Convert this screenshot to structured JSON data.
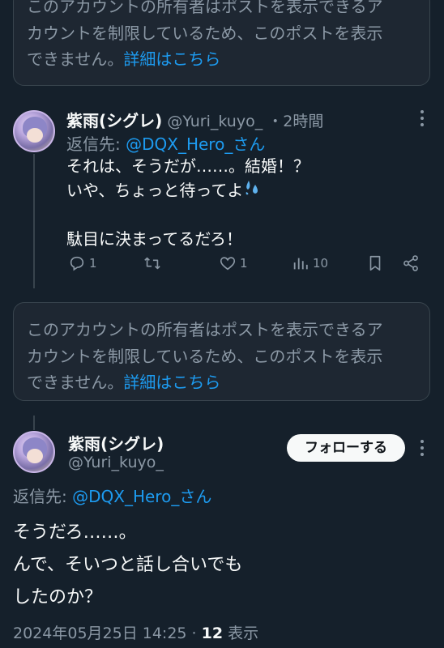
{
  "notice_top": {
    "lines": [
      "このアカウントの所有者はポストを表示できるア",
      "カウントを制限しているため、このポストを表示",
      "できません。"
    ],
    "link": "詳細はこちら"
  },
  "tweet1": {
    "display_name": "紫雨(シグレ)",
    "handle": "@Yuri_kuyo_",
    "time": "・2時間",
    "reply_prefix": "返信先: ",
    "reply_handle": "@DQX_Hero_さん",
    "body_lines": [
      "それは、そうだが……。結婚！？",
      "いや、ちょっと待ってよ",
      "",
      "駄目に決まってるだろ！"
    ],
    "emoji_icon": "sweat-drops-icon",
    "actions": {
      "reply_count": "1",
      "retweet_count": "",
      "like_count": "1",
      "view_count": "10"
    }
  },
  "notice_bottom": {
    "lines": [
      "このアカウントの所有者はポストを表示できるア",
      "カウントを制限しているため、このポストを表示",
      "できません。"
    ],
    "link": "詳細はこちら"
  },
  "tweet2": {
    "display_name": "紫雨(シグレ)",
    "handle": "@Yuri_kuyo_",
    "follow_label": "フォローする",
    "reply_prefix": "返信先: ",
    "reply_handle": "@DQX_Hero_さん",
    "body_lines": [
      "そうだろ……。",
      "んで、そいつと話し合いでも",
      "したのか？"
    ],
    "timestamp": "2024年05月25日 14:25 · ",
    "views_count": "12",
    "views_label": " 表示"
  },
  "colors": {
    "background": "#15202b",
    "notice_bg": "#1e2732",
    "link": "#1d9bf0",
    "muted": "#8b98a5",
    "text": "#f7f9f9"
  }
}
